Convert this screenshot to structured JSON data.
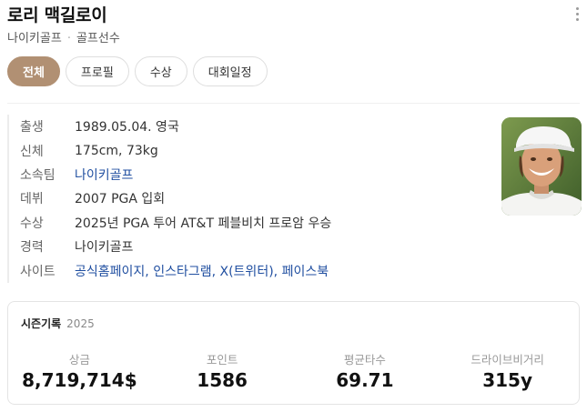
{
  "header": {
    "name": "로리 맥길로이",
    "subtitle_team": "나이키골프",
    "subtitle_role": "골프선수"
  },
  "tabs": [
    {
      "label": "전체",
      "active": true
    },
    {
      "label": "프로필",
      "active": false
    },
    {
      "label": "수상",
      "active": false
    },
    {
      "label": "대회일정",
      "active": false
    }
  ],
  "profile": {
    "birth_label": "출생",
    "birth_value": "1989.05.04. 영국",
    "body_label": "신체",
    "body_value": "175cm, 73kg",
    "team_label": "소속팀",
    "team_value": "나이키골프",
    "debut_label": "데뷔",
    "debut_value": "2007 PGA 입회",
    "award_label": "수상",
    "award_value": "2025년 PGA 투어 AT&T 페블비치 프로암 우승",
    "career_label": "경력",
    "career_value": "나이키골프",
    "site_label": "사이트",
    "sites": [
      "공식홈페이지",
      "인스타그램",
      "X(트위터)",
      "페이스북"
    ]
  },
  "season": {
    "title": "시즌기록",
    "year": "2025",
    "stats": [
      {
        "label": "상금",
        "value": "8,719,714$"
      },
      {
        "label": "포인트",
        "value": "1586"
      },
      {
        "label": "평균타수",
        "value": "69.71"
      },
      {
        "label": "드라이브비거리",
        "value": "315y"
      }
    ]
  },
  "colors": {
    "active_tab": "#b19073",
    "link": "#1f4ea0"
  }
}
